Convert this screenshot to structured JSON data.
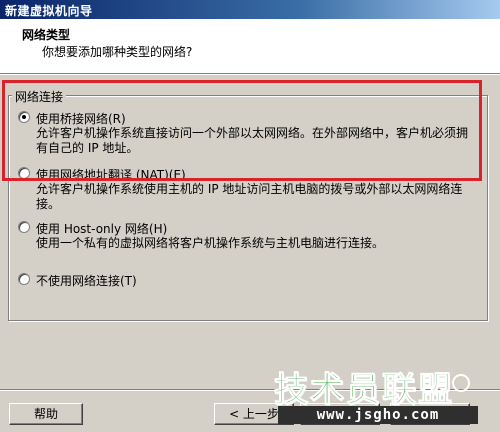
{
  "window": {
    "title": "新建虚拟机向导"
  },
  "header": {
    "title": "网络类型",
    "subtitle": "你想要添加哪种类型的网络?"
  },
  "group": {
    "legend": "网络连接"
  },
  "options": [
    {
      "label": "使用桥接网络(R)",
      "description": "允许客户机操作系统直接访问一个外部以太网网络。在外部网络中，客户机必须拥有自己的 IP 地址。",
      "selected": true
    },
    {
      "label": "使用网络地址翻译 (NAT)(E)",
      "description": "允许客户机操作系统使用主机的 IP 地址访问主机电脑的拨号或外部以太网网络连接。",
      "selected": false
    },
    {
      "label": "使用 Host-only 网络(H)",
      "description": "使用一个私有的虚拟网络将客户机操作系统与主机电脑进行连接。",
      "selected": false
    },
    {
      "label": "不使用网络连接(T)",
      "description": "",
      "selected": false
    }
  ],
  "buttons": {
    "help": "帮助",
    "back": "< 上一步",
    "next": "",
    "cancel": ""
  },
  "watermark": {
    "brand": "技术员联盟",
    "url": "www.jsgho.com"
  },
  "colors": {
    "highlight": "#d8232a",
    "titlebar": "#0a246a",
    "watermark_green": "#3fae49"
  }
}
